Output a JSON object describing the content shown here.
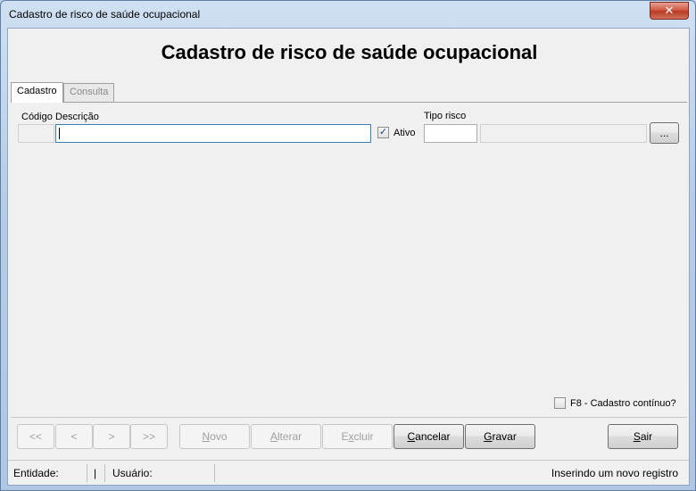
{
  "window": {
    "title": "Cadastro de risco de saúde ocupacional",
    "close_label": "✕"
  },
  "header": {
    "heading": "Cadastro de risco de saúde ocupacional"
  },
  "tabs": [
    {
      "label": "Cadastro",
      "active": true
    },
    {
      "label": "Consulta",
      "active": false
    }
  ],
  "form": {
    "codigo_label": "Código",
    "codigo_value": "",
    "descricao_label": "Descrição",
    "descricao_value": "",
    "ativo_label": "Ativo",
    "ativo_checked": true,
    "tipo_risco_label": "Tipo risco",
    "tipo_risco_code": "",
    "tipo_risco_desc": "",
    "browse_label": "..."
  },
  "continuous": {
    "label": "F8 - Cadastro contínuo?",
    "checked": false
  },
  "nav": {
    "first": "<<",
    "prev": "<",
    "next": ">",
    "last": ">>"
  },
  "actions": {
    "novo_pre": "",
    "novo_key": "N",
    "novo_post": "ovo",
    "alterar_pre": "",
    "alterar_key": "A",
    "alterar_post": "lterar",
    "excluir_pre": "E",
    "excluir_key": "x",
    "excluir_post": "cluir",
    "cancelar_pre": "",
    "cancelar_key": "C",
    "cancelar_post": "ancelar",
    "gravar_pre": "",
    "gravar_key": "G",
    "gravar_post": "ravar",
    "sair_pre": "",
    "sair_key": "S",
    "sair_post": "air"
  },
  "status": {
    "entidade_label": "Entidade:",
    "separator": "|",
    "usuario_label": "Usuário:",
    "message": "Inserindo um novo registro"
  }
}
